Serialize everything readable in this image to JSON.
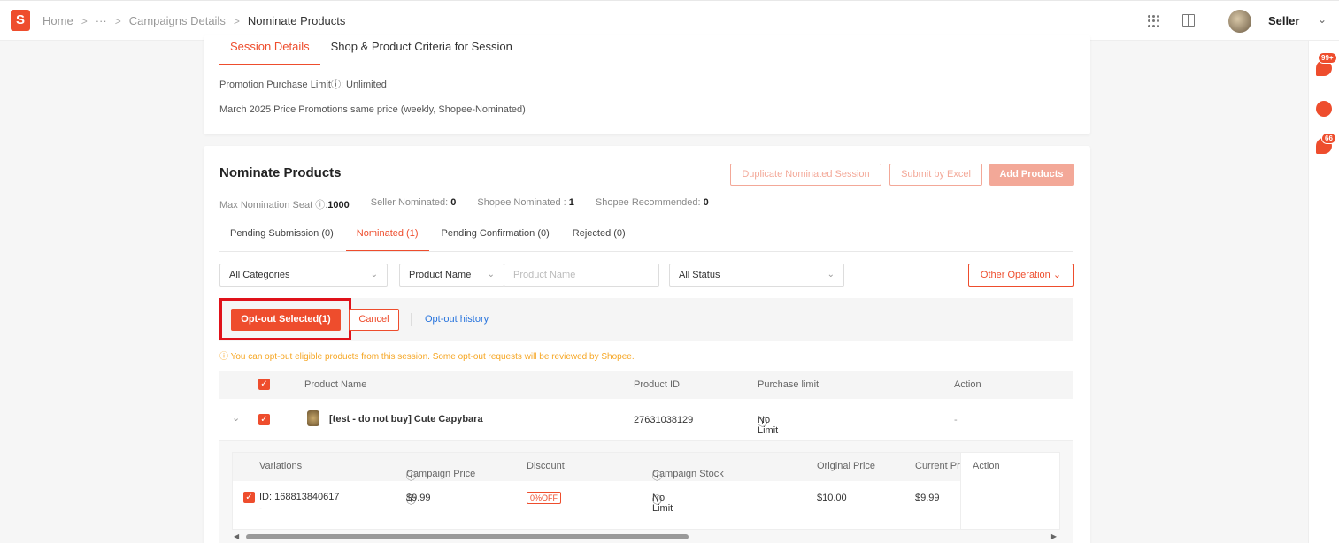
{
  "header": {
    "logo": "S",
    "breadcrumbs": [
      "Home",
      "···",
      "Campaigns Details",
      "Nominate Products"
    ],
    "seller_name": "Seller"
  },
  "side": {
    "notif_badge": "99+",
    "chat_badge": "66"
  },
  "session_card": {
    "tabs": [
      "Session Details",
      "Shop & Product Criteria for Session"
    ],
    "purchase_limit": "Promotion Purchase Limitⓘ: Unlimited",
    "description": "March 2025 Price Promotions same price (weekly, Shopee-Nominated)"
  },
  "nominate": {
    "title": "Nominate Products",
    "buttons": {
      "duplicate": "Duplicate Nominated Session",
      "excel": "Submit by Excel",
      "add": "Add Products"
    },
    "stats": [
      {
        "label": "Max Nomination Seat ⓘ:",
        "value": "1000"
      },
      {
        "label": "Seller Nominated:",
        "value": "0"
      },
      {
        "label": "Shopee Nominated :",
        "value": "1"
      },
      {
        "label": "Shopee Recommended:",
        "value": "0"
      }
    ],
    "tabs": [
      "Pending Submission (0)",
      "Nominated (1)",
      "Pending Confirmation (0)",
      "Rejected (0)"
    ],
    "filters": {
      "category": "All Categories",
      "search_type": "Product Name",
      "search_placeholder": "Product Name",
      "status": "All Status",
      "other_operation": "Other Operation"
    },
    "actions": {
      "opt_out": "Opt-out Selected(1)",
      "cancel": "Cancel",
      "history": "Opt-out history"
    },
    "notice": "You can opt-out eligible products from this session. Some opt-out requests will be reviewed by Shopee.",
    "table": {
      "headers": [
        "Product Name",
        "Product ID",
        "Purchase limit",
        "Action"
      ],
      "product": {
        "name": "[test - do not buy] Cute Capybara",
        "id": "27631038129",
        "limit": "No Limit",
        "action": "-"
      }
    },
    "variations": {
      "headers": [
        "Variations",
        "Campaign Price",
        "Discount",
        "Campaign Stock",
        "Original Price",
        "Current Pri",
        "Action"
      ],
      "row": {
        "id": "ID: 168813840617",
        "sub": "-",
        "campaign_price": "$9.99",
        "discount": "0%OFF",
        "stock": "No Limit",
        "original_price": "$10.00",
        "current_price": "$9.99"
      }
    }
  }
}
